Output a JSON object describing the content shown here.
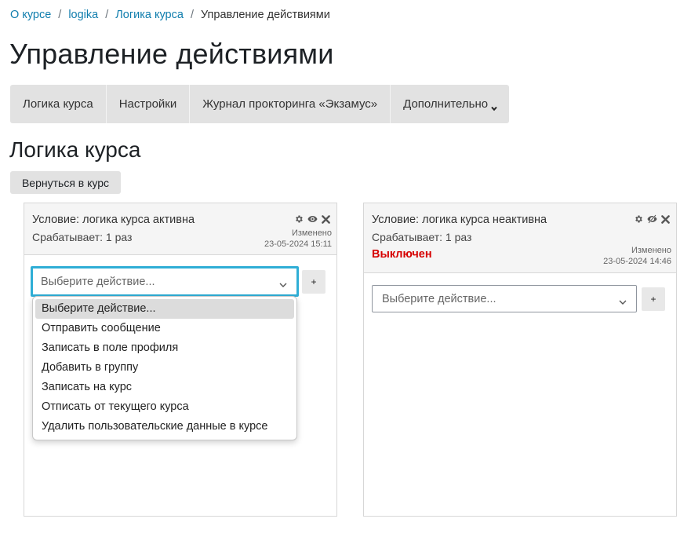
{
  "breadcrumb": {
    "items": [
      "О курсе",
      "logika",
      "Логика курса"
    ],
    "current": "Управление действиями"
  },
  "page_title": "Управление действиями",
  "tabs": [
    {
      "label": "Логика курса"
    },
    {
      "label": "Настройки"
    },
    {
      "label": "Журнал прокторинга «Экзамус»"
    },
    {
      "label": "Дополнительно"
    }
  ],
  "section_title": "Логика курса",
  "back_button": "Вернуться в курс",
  "cards": [
    {
      "condition": "Условие: логика курса активна",
      "fires": "Срабатывает: 1 раз",
      "changed_label": "Изменено",
      "changed_date": "23-05-2024 15:11",
      "select_placeholder": "Выберите действие...",
      "plus": "+"
    },
    {
      "condition": "Условие: логика курса неактивна",
      "fires": "Срабатывает: 1 раз",
      "status": "Выключен",
      "changed_label": "Изменено",
      "changed_date": "23-05-2024 14:46",
      "select_placeholder": "Выберите действие...",
      "plus": "+"
    }
  ],
  "dropdown": {
    "options": [
      "Выберите действие...",
      "Отправить сообщение",
      "Записать в поле профиля",
      "Добавить в группу",
      "Записать на курс",
      "Отписать от текущего курса",
      "Удалить пользовательские данные в курсе"
    ],
    "selected_index": 0
  },
  "colors": {
    "link": "#0f7dad",
    "focus": "#2faed6",
    "disabled": "#d60000",
    "tab_bg": "#e2e2e2"
  }
}
